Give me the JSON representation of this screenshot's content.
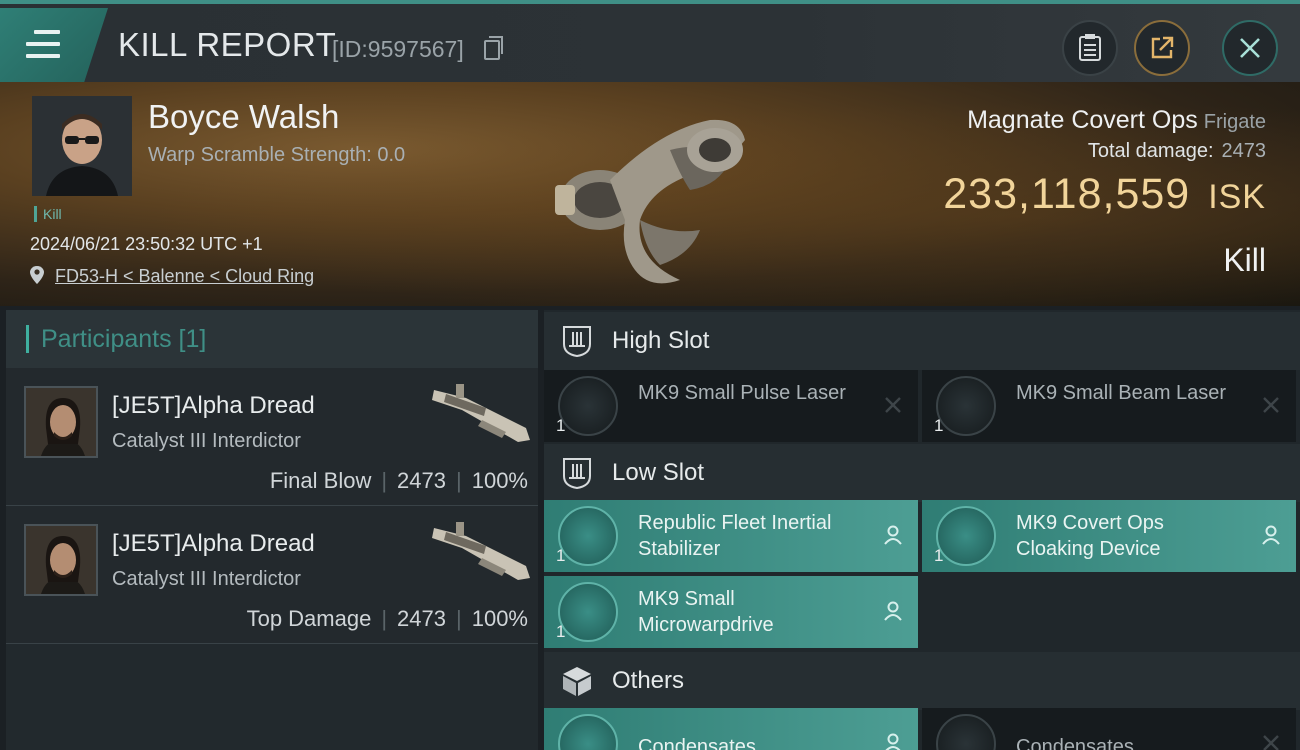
{
  "header": {
    "title": "KILL REPORT",
    "id_label": "[ID:9597567]"
  },
  "victim": {
    "name": "Boyce Walsh",
    "warp_scramble": "Warp Scramble Strength: 0.0",
    "tag": "Kill",
    "timestamp": "2024/06/21 23:50:32 UTC +1",
    "location": "FD53-H < Balenne < Cloud Ring"
  },
  "ship": {
    "name": "Magnate Covert Ops",
    "class": "Frigate",
    "total_damage_label": "Total damage:",
    "total_damage": "2473",
    "isk_value": "233,118,559",
    "isk_unit": "ISK",
    "result": "Kill"
  },
  "participants": {
    "heading": "Participants [1]",
    "rows": [
      {
        "name": "[JE5T]Alpha Dread",
        "ship": "Catalyst III Interdictor",
        "role": "Final Blow",
        "damage": "2473",
        "percent": "100%"
      },
      {
        "name": "[JE5T]Alpha Dread",
        "ship": "Catalyst III Interdictor",
        "role": "Top Damage",
        "damage": "2473",
        "percent": "100%"
      }
    ]
  },
  "slots": {
    "high": {
      "label": "High Slot",
      "items": [
        {
          "name": "MK9 Small Pulse Laser",
          "qty": "1",
          "state": "destroyed"
        },
        {
          "name": "MK9 Small Beam Laser",
          "qty": "1",
          "state": "destroyed"
        }
      ]
    },
    "low": {
      "label": "Low Slot",
      "items": [
        {
          "name": "Republic Fleet Inertial Stabilizer",
          "qty": "1",
          "state": "dropped"
        },
        {
          "name": "MK9 Covert Ops Cloaking Device",
          "qty": "1",
          "state": "dropped"
        },
        {
          "name": "MK9 Small Microwarpdrive",
          "qty": "1",
          "state": "dropped"
        }
      ]
    },
    "others": {
      "label": "Others",
      "items": [
        {
          "name": "Condensates",
          "qty": "",
          "state": "dropped"
        },
        {
          "name": "Condensates",
          "qty": "",
          "state": "destroyed"
        }
      ]
    }
  },
  "colors": {
    "accent_teal": "#3f8f86",
    "isk_gold": "#f1d49a",
    "dropped_bg": "#4d9e94",
    "destroyed_bg": "#161b1e"
  },
  "icons": [
    "menu-icon",
    "copy-icon",
    "report-icon",
    "share-icon",
    "close-icon",
    "location-pin-icon",
    "high-slot-icon",
    "low-slot-icon",
    "cargo-box-icon",
    "person-icon",
    "cross-icon"
  ]
}
